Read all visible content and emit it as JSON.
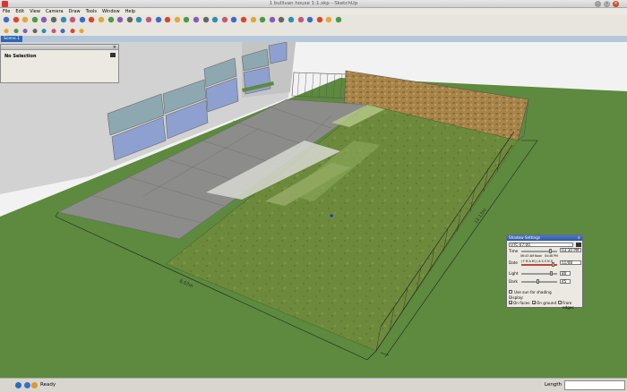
{
  "window": {
    "title": "1 bullivan house 1:1.skp - SketchUp"
  },
  "menu": [
    "File",
    "Edit",
    "View",
    "Camera",
    "Draw",
    "Tools",
    "Window",
    "Help"
  ],
  "toolbar1_icons": [
    "select-icon",
    "eraser-icon",
    "paint-bucket-icon",
    "make-component-icon",
    "eraser-alt-icon",
    "rectangle-icon",
    "line-icon",
    "circle-icon",
    "arc-icon",
    "polygon-icon",
    "freehand-icon",
    "move-icon",
    "push-pull-icon",
    "rotate-icon",
    "follow-me-icon",
    "scale-icon",
    "offset-icon",
    "tape-measure-icon",
    "dimension-icon",
    "protractor-icon",
    "text-icon",
    "axes-icon",
    "3d-text-icon",
    "orbit-icon",
    "pan-icon",
    "zoom-icon",
    "zoom-window-icon",
    "zoom-extents-icon",
    "previous-view-icon",
    "next-view-icon",
    "position-camera-icon",
    "walk-icon",
    "look-around-icon",
    "section-plane-icon",
    "get-models-icon",
    "share-model-icon"
  ],
  "toolbar2_icons": [
    "folder-open-icon",
    "print-icon",
    "person-icon",
    "layers-icon",
    "styles-icon",
    "shadows-icon",
    "fog-icon",
    "components-icon",
    "materials-icon"
  ],
  "scene_tab": "Scene 1",
  "entity_info": {
    "selection": "No Selection"
  },
  "viewport": {
    "dim_bottom": "8.07m",
    "dim_right": "12.13m"
  },
  "shadow_settings": {
    "title": "Shadow Settings",
    "timezone": "UTC-07:00",
    "time_label": "Time",
    "time_value": "03:30 PM",
    "time_start": "06:43 AM",
    "time_noon": "Noon",
    "time_end": "04:46 PM",
    "date_label": "Date",
    "date_value": "11/08",
    "date_months": "J F M A M J J A S O N D",
    "light_label": "Light",
    "light_value": "80",
    "dark_label": "Dark",
    "dark_value": "45",
    "use_sun": "Use sun for shading",
    "display_label": "Display:",
    "on_faces": "On faces",
    "on_ground": "On ground",
    "from_edges": "From edges",
    "checks": {
      "use_sun": false,
      "on_faces": true,
      "on_ground": true,
      "from_edges": false
    }
  },
  "status": {
    "ready": "Ready",
    "measurements_label": "Length"
  },
  "colors": {
    "grass": "#6b8a3a",
    "ground": "#5c8a3c",
    "paving": "#8c8c8a",
    "wall": "#b48a4a"
  }
}
